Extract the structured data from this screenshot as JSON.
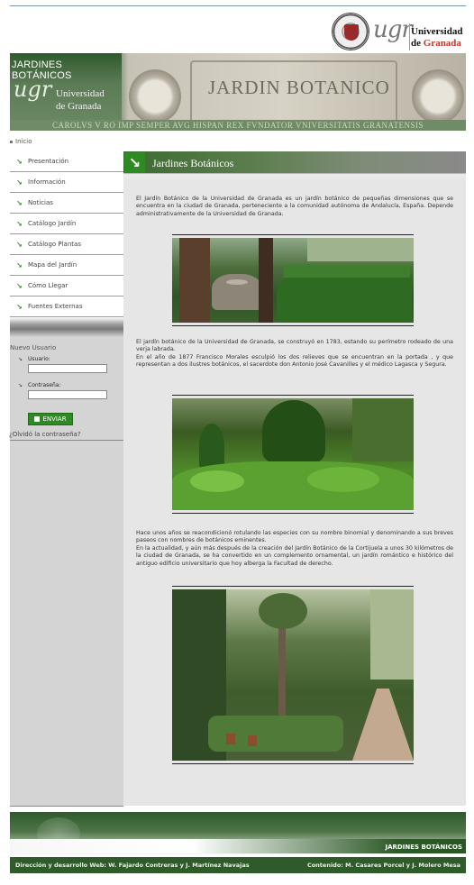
{
  "university": {
    "logo_text": "ugr",
    "name_line1": "Universidad",
    "name_line2_prefix": "de ",
    "name_line2_city": "Granada"
  },
  "banner": {
    "title": "JARDINES BOTÁNICOS",
    "logo_text": "ugr",
    "uni_line1": "Universidad",
    "uni_line2": "de Granada",
    "sign_text": "JARDIN BOTANICO",
    "latin_motto": "CAROLVS V RO IMP SEMPER AVG HISPAN REX FVNDATOR VNIVERSITATIS GRANATENSIS"
  },
  "breadcrumb": {
    "home": "Inicio"
  },
  "sidebar": {
    "nav": [
      {
        "label": "Presentación"
      },
      {
        "label": "Información"
      },
      {
        "label": "Noticias"
      },
      {
        "label": "Catálogo Jardín"
      },
      {
        "label": "Catálogo Plantas"
      },
      {
        "label": "Mapa del Jardín"
      },
      {
        "label": "Cómo Llegar"
      },
      {
        "label": "Fuentes Externas"
      }
    ],
    "login": {
      "title": "Nuevo Usuario",
      "user_label": "Usuario:",
      "user_value": "",
      "password_label": "Contraseña:",
      "password_value": "",
      "submit_label": "ENVIAR",
      "forgot_label": "¿Olvidó la contraseña?"
    }
  },
  "main": {
    "title": "Jardines Botánicos",
    "p1": "El Jardín Botánico de la Universidad de Granada es un jardín botánico de pequeñas dimensiones que se encuentra en la ciudad de Granada, perteneciente a la comunidad autónoma de Andalucía, España. Depende administrativamente de la Universidad de Granada.",
    "p2a": "El jardín botánico de la Universidad de Granada, se construyó en 1783, estando su perímetro rodeado de una verja labrada.",
    "p2b": "En el año de 1877 Francisco Morales esculpió los dos relieves que se encuentran en la portada , y que representan a dos ilustres botánicos, el sacerdote don Antonio José Cavanilles y el médico Lagasca y Segura.",
    "p3a": "Hace unos años se reacondicionó rotulando las especies con su nombre binomial y denominando a sus breves paseos con nombres de botánicos eminentes.",
    "p3b": "En la actualidad, y aún más después de la creación del Jardín Botánico de la Cortijuela a unos 30 kilómetros de la ciudad de Granada, se ha convertido en un complemento ornamental, un jardín romántico e histórico del antiguo edificio universitario que hoy alberga la Facultad de derecho."
  },
  "footer": {
    "title": "JARDINES BOTÁNICOS",
    "credits_left": "Dirección y desarrollo Web: W. Fajardo Contreras y J. Martínez Navajas",
    "credits_right": "Contenido: M. Casares Porcel y J. Molero Mesa"
  },
  "colors": {
    "accent_green": "#2e8a22",
    "header_green": "#3c6a30",
    "sidebar_gray": "#d4d4d4",
    "content_gray": "#e6e6e6",
    "footer_green": "#2f5a2a"
  }
}
